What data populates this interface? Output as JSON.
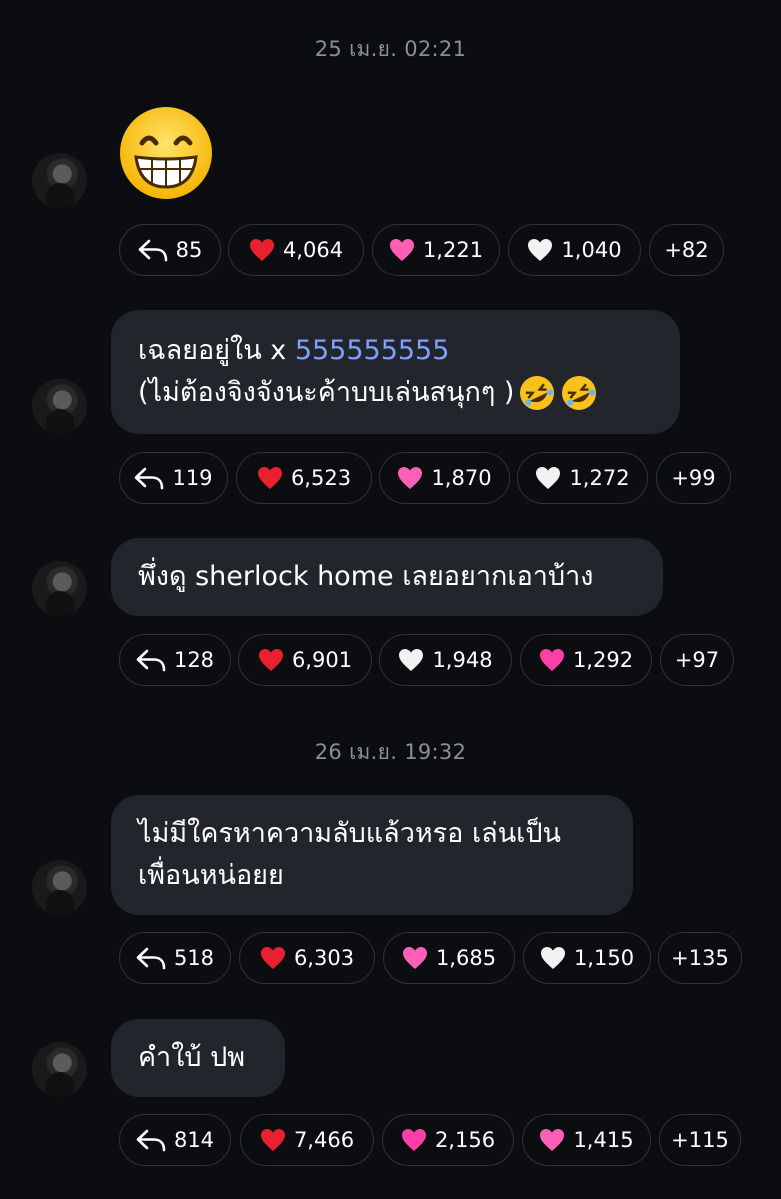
{
  "colors": {
    "background": "#0b0d11",
    "bubble": "#22252b",
    "link": "#7ea1ff",
    "timestamp": "#8a8e96",
    "red_heart": "#e8202f",
    "pink_heart": "#ff5fb4",
    "white_heart": "#f2f2f2"
  },
  "timestamps": [
    "25 เม.ย. 02:21",
    "26 เม.ย. 19:32"
  ],
  "messages": [
    {
      "type": "emoji",
      "emoji_icon": "grinning-face-emoji",
      "reactions": {
        "reply": "85",
        "items": [
          {
            "icon": "red-heart",
            "count": "4,064"
          },
          {
            "icon": "pink-sparkling-heart",
            "count": "1,221"
          },
          {
            "icon": "white-heart",
            "count": "1,040"
          }
        ],
        "more": "+82"
      }
    },
    {
      "type": "text",
      "line1_prefix": "เฉลยอยู่ใน x ",
      "line1_link": "555555555",
      "line2": "(ไม่ต้องจิงจังนะค้าบบเล่นสนุกๆ ) ",
      "line2_emoji": "rolling-on-floor-laughing-emoji",
      "reactions": {
        "reply": "119",
        "items": [
          {
            "icon": "red-heart",
            "count": "6,523"
          },
          {
            "icon": "pink-sparkling-heart",
            "count": "1,870"
          },
          {
            "icon": "white-heart",
            "count": "1,272"
          }
        ],
        "more": "+99"
      }
    },
    {
      "type": "text",
      "line1": "พึ่งดู sherlock home เลยอยากเอาบ้าง",
      "reactions": {
        "reply": "128",
        "items": [
          {
            "icon": "red-heart",
            "count": "6,901"
          },
          {
            "icon": "white-heart",
            "count": "1,948"
          },
          {
            "icon": "pink-heart",
            "count": "1,292"
          }
        ],
        "more": "+97"
      }
    },
    {
      "type": "text",
      "line1": "ไม่มีใครหาความลับแล้วหรอ เล่นเป็น",
      "line2": "เพื่อนหน่อยย",
      "reactions": {
        "reply": "518",
        "items": [
          {
            "icon": "red-heart",
            "count": "6,303"
          },
          {
            "icon": "pink-sparkling-heart",
            "count": "1,685"
          },
          {
            "icon": "white-heart",
            "count": "1,150"
          }
        ],
        "more": "+135"
      }
    },
    {
      "type": "text",
      "line1": "คำใบ้ ปพ",
      "reactions": {
        "reply": "814",
        "items": [
          {
            "icon": "red-heart",
            "count": "7,466"
          },
          {
            "icon": "pink-heart",
            "count": "2,156"
          },
          {
            "icon": "pink-sparkling-heart",
            "count": "1,415"
          }
        ],
        "more": "+115"
      }
    }
  ]
}
